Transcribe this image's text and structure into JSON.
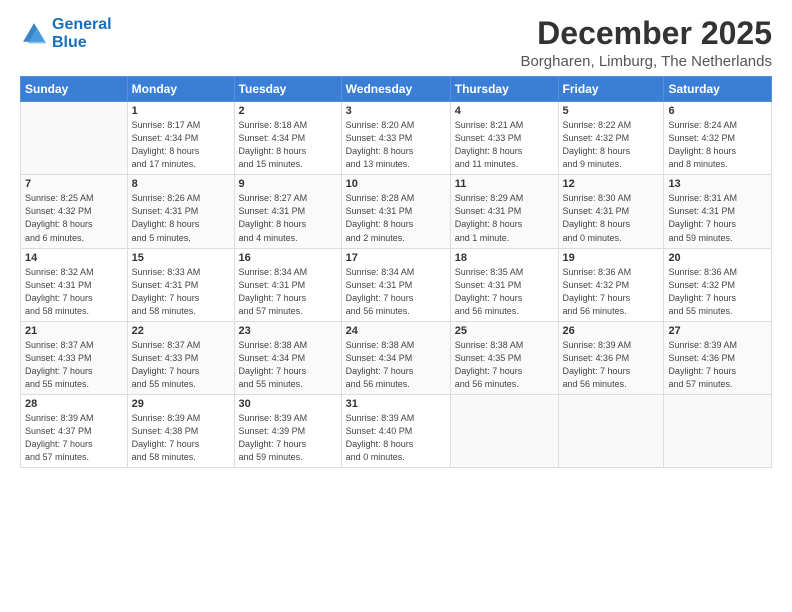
{
  "logo": {
    "line1": "General",
    "line2": "Blue"
  },
  "title": "December 2025",
  "subtitle": "Borgharen, Limburg, The Netherlands",
  "weekdays": [
    "Sunday",
    "Monday",
    "Tuesday",
    "Wednesday",
    "Thursday",
    "Friday",
    "Saturday"
  ],
  "weeks": [
    [
      {
        "day": "",
        "info": ""
      },
      {
        "day": "1",
        "info": "Sunrise: 8:17 AM\nSunset: 4:34 PM\nDaylight: 8 hours\nand 17 minutes."
      },
      {
        "day": "2",
        "info": "Sunrise: 8:18 AM\nSunset: 4:34 PM\nDaylight: 8 hours\nand 15 minutes."
      },
      {
        "day": "3",
        "info": "Sunrise: 8:20 AM\nSunset: 4:33 PM\nDaylight: 8 hours\nand 13 minutes."
      },
      {
        "day": "4",
        "info": "Sunrise: 8:21 AM\nSunset: 4:33 PM\nDaylight: 8 hours\nand 11 minutes."
      },
      {
        "day": "5",
        "info": "Sunrise: 8:22 AM\nSunset: 4:32 PM\nDaylight: 8 hours\nand 9 minutes."
      },
      {
        "day": "6",
        "info": "Sunrise: 8:24 AM\nSunset: 4:32 PM\nDaylight: 8 hours\nand 8 minutes."
      }
    ],
    [
      {
        "day": "7",
        "info": "Sunrise: 8:25 AM\nSunset: 4:32 PM\nDaylight: 8 hours\nand 6 minutes."
      },
      {
        "day": "8",
        "info": "Sunrise: 8:26 AM\nSunset: 4:31 PM\nDaylight: 8 hours\nand 5 minutes."
      },
      {
        "day": "9",
        "info": "Sunrise: 8:27 AM\nSunset: 4:31 PM\nDaylight: 8 hours\nand 4 minutes."
      },
      {
        "day": "10",
        "info": "Sunrise: 8:28 AM\nSunset: 4:31 PM\nDaylight: 8 hours\nand 2 minutes."
      },
      {
        "day": "11",
        "info": "Sunrise: 8:29 AM\nSunset: 4:31 PM\nDaylight: 8 hours\nand 1 minute."
      },
      {
        "day": "12",
        "info": "Sunrise: 8:30 AM\nSunset: 4:31 PM\nDaylight: 8 hours\nand 0 minutes."
      },
      {
        "day": "13",
        "info": "Sunrise: 8:31 AM\nSunset: 4:31 PM\nDaylight: 7 hours\nand 59 minutes."
      }
    ],
    [
      {
        "day": "14",
        "info": "Sunrise: 8:32 AM\nSunset: 4:31 PM\nDaylight: 7 hours\nand 58 minutes."
      },
      {
        "day": "15",
        "info": "Sunrise: 8:33 AM\nSunset: 4:31 PM\nDaylight: 7 hours\nand 58 minutes."
      },
      {
        "day": "16",
        "info": "Sunrise: 8:34 AM\nSunset: 4:31 PM\nDaylight: 7 hours\nand 57 minutes."
      },
      {
        "day": "17",
        "info": "Sunrise: 8:34 AM\nSunset: 4:31 PM\nDaylight: 7 hours\nand 56 minutes."
      },
      {
        "day": "18",
        "info": "Sunrise: 8:35 AM\nSunset: 4:31 PM\nDaylight: 7 hours\nand 56 minutes."
      },
      {
        "day": "19",
        "info": "Sunrise: 8:36 AM\nSunset: 4:32 PM\nDaylight: 7 hours\nand 56 minutes."
      },
      {
        "day": "20",
        "info": "Sunrise: 8:36 AM\nSunset: 4:32 PM\nDaylight: 7 hours\nand 55 minutes."
      }
    ],
    [
      {
        "day": "21",
        "info": "Sunrise: 8:37 AM\nSunset: 4:33 PM\nDaylight: 7 hours\nand 55 minutes."
      },
      {
        "day": "22",
        "info": "Sunrise: 8:37 AM\nSunset: 4:33 PM\nDaylight: 7 hours\nand 55 minutes."
      },
      {
        "day": "23",
        "info": "Sunrise: 8:38 AM\nSunset: 4:34 PM\nDaylight: 7 hours\nand 55 minutes."
      },
      {
        "day": "24",
        "info": "Sunrise: 8:38 AM\nSunset: 4:34 PM\nDaylight: 7 hours\nand 56 minutes."
      },
      {
        "day": "25",
        "info": "Sunrise: 8:38 AM\nSunset: 4:35 PM\nDaylight: 7 hours\nand 56 minutes."
      },
      {
        "day": "26",
        "info": "Sunrise: 8:39 AM\nSunset: 4:36 PM\nDaylight: 7 hours\nand 56 minutes."
      },
      {
        "day": "27",
        "info": "Sunrise: 8:39 AM\nSunset: 4:36 PM\nDaylight: 7 hours\nand 57 minutes."
      }
    ],
    [
      {
        "day": "28",
        "info": "Sunrise: 8:39 AM\nSunset: 4:37 PM\nDaylight: 7 hours\nand 57 minutes."
      },
      {
        "day": "29",
        "info": "Sunrise: 8:39 AM\nSunset: 4:38 PM\nDaylight: 7 hours\nand 58 minutes."
      },
      {
        "day": "30",
        "info": "Sunrise: 8:39 AM\nSunset: 4:39 PM\nDaylight: 7 hours\nand 59 minutes."
      },
      {
        "day": "31",
        "info": "Sunrise: 8:39 AM\nSunset: 4:40 PM\nDaylight: 8 hours\nand 0 minutes."
      },
      {
        "day": "",
        "info": ""
      },
      {
        "day": "",
        "info": ""
      },
      {
        "day": "",
        "info": ""
      }
    ]
  ]
}
